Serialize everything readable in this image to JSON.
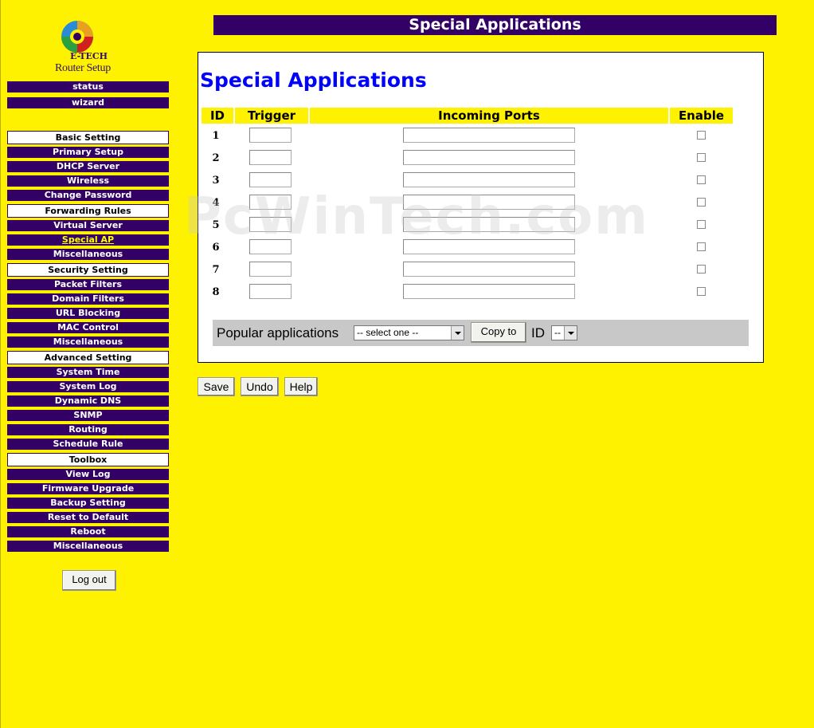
{
  "logo": {
    "brand": "E-TECH",
    "subtitle": "Router Setup"
  },
  "sidebar": {
    "items": [
      {
        "label": "status"
      },
      {
        "label": "wizard"
      },
      {
        "label": "Basic Setting"
      },
      {
        "label": "Primary Setup"
      },
      {
        "label": "DHCP Server"
      },
      {
        "label": "Wireless"
      },
      {
        "label": "Change Password"
      },
      {
        "label": "Forwarding Rules"
      },
      {
        "label": "Virtual Server"
      },
      {
        "label": "Special AP"
      },
      {
        "label": "Miscellaneous"
      },
      {
        "label": "Security Setting"
      },
      {
        "label": "Packet Filters"
      },
      {
        "label": "Domain Filters"
      },
      {
        "label": "URL Blocking"
      },
      {
        "label": "MAC Control"
      },
      {
        "label": "Miscellaneous"
      },
      {
        "label": "Advanced Setting"
      },
      {
        "label": "System Time"
      },
      {
        "label": "System Log"
      },
      {
        "label": "Dynamic DNS"
      },
      {
        "label": "SNMP"
      },
      {
        "label": "Routing"
      },
      {
        "label": "Schedule Rule"
      },
      {
        "label": "Toolbox"
      },
      {
        "label": "View Log"
      },
      {
        "label": "Firmware Upgrade"
      },
      {
        "label": "Backup Setting"
      },
      {
        "label": "Reset to Default"
      },
      {
        "label": "Reboot"
      },
      {
        "label": "Miscellaneous"
      }
    ],
    "logout_label": "Log out"
  },
  "header": {
    "title": "Special Applications"
  },
  "main": {
    "title": "Special Applications",
    "columns": [
      "ID",
      "Trigger",
      "Incoming Ports",
      "Enable"
    ],
    "rows": [
      {
        "id": "1",
        "trigger": "",
        "ports": "",
        "enabled": false
      },
      {
        "id": "2",
        "trigger": "",
        "ports": "",
        "enabled": false
      },
      {
        "id": "3",
        "trigger": "",
        "ports": "",
        "enabled": false
      },
      {
        "id": "4",
        "trigger": "",
        "ports": "",
        "enabled": false
      },
      {
        "id": "5",
        "trigger": "",
        "ports": "",
        "enabled": false
      },
      {
        "id": "6",
        "trigger": "",
        "ports": "",
        "enabled": false
      },
      {
        "id": "7",
        "trigger": "",
        "ports": "",
        "enabled": false
      },
      {
        "id": "8",
        "trigger": "",
        "ports": "",
        "enabled": false
      }
    ],
    "popular": {
      "label": "Popular applications",
      "select_value": "-- select one --",
      "copy_label": "Copy to",
      "id_label": "ID",
      "id_value": "--"
    }
  },
  "buttons": {
    "save": "Save",
    "undo": "Undo",
    "help": "Help"
  },
  "watermark": "PcWinTech.com",
  "colors": {
    "background": "#FFF200",
    "nav": "#330066",
    "title": "#0000FF"
  }
}
